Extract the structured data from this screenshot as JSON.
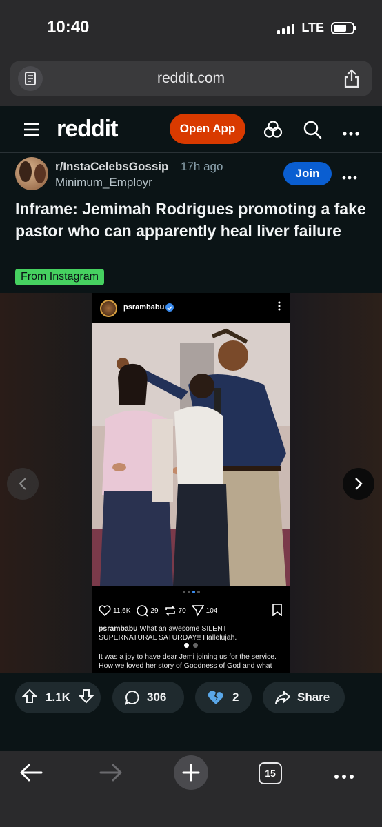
{
  "status_bar": {
    "time": "10:40",
    "network": "LTE",
    "battery_level": 0.7
  },
  "browser": {
    "url": "reddit.com",
    "tab_count": "15"
  },
  "header": {
    "logo": "reddit",
    "open_app_label": "Open App"
  },
  "post": {
    "subreddit": "r/InstaCelebsGossip",
    "time_ago": "17h ago",
    "author": "Minimum_Employr",
    "join_label": "Join",
    "title": "Inframe: Jemimah Rodrigues promoting a fake pastor who can apparently heal liver failure",
    "flair": "From Instagram",
    "flair_color": "#46d160"
  },
  "embed": {
    "username": "psrambabu",
    "likes": "11.6K",
    "comments": "29",
    "reposts": "70",
    "shares": "104",
    "caption_user": "psrambabu",
    "caption_text": "What an awesome SILENT SUPERNATURAL SATURDAY!! Hallelujah.",
    "caption_more": "It was a joy to have dear Jemi joining us for the service. How we loved her story of Goodness of God and what"
  },
  "actions": {
    "upvotes": "1.1K",
    "comments": "306",
    "awards": "2",
    "share_label": "Share"
  },
  "colors": {
    "accent": "#d93a00",
    "join": "#0a5ed1",
    "background": "#0b1416"
  }
}
